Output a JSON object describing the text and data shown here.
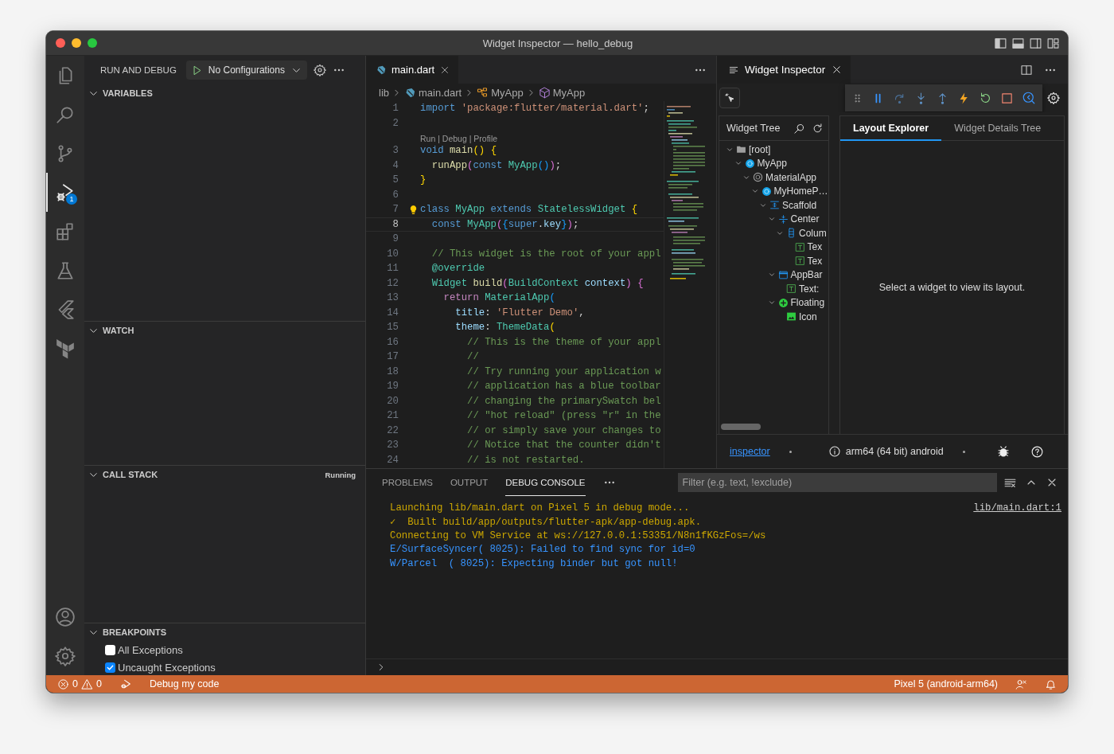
{
  "window": {
    "title": "Widget Inspector — hello_debug"
  },
  "activity_bar": {
    "items": [
      {
        "kind": "files",
        "selected": false
      },
      {
        "kind": "search",
        "selected": false
      },
      {
        "kind": "source-control",
        "selected": false
      },
      {
        "kind": "run-debug",
        "selected": true,
        "badge": "1"
      },
      {
        "kind": "extensions",
        "selected": false
      },
      {
        "kind": "testing",
        "selected": false
      },
      {
        "kind": "flutter",
        "selected": false
      },
      {
        "kind": "terraform",
        "selected": false
      }
    ],
    "bottom_items": [
      {
        "kind": "account"
      },
      {
        "kind": "manage"
      }
    ]
  },
  "sidebar": {
    "title": "RUN AND DEBUG",
    "configuration": "No Configurations",
    "sections": [
      {
        "title": "VARIABLES",
        "expanded": true
      },
      {
        "title": "WATCH",
        "expanded": true
      },
      {
        "title": "CALL STACK",
        "expanded": true,
        "status": "Running"
      },
      {
        "title": "BREAKPOINTS",
        "expanded": true,
        "items": [
          {
            "label": "All Exceptions",
            "checked": false
          },
          {
            "label": "Uncaught Exceptions",
            "checked": true
          }
        ]
      }
    ]
  },
  "editor": {
    "tabs": [
      {
        "label": "main.dart",
        "selected": true
      }
    ],
    "breadcrumbs": [
      {
        "label": "lib",
        "kind": "folder"
      },
      {
        "label": "main.dart",
        "kind": "file"
      },
      {
        "label": "MyApp",
        "kind": "class"
      },
      {
        "label": "MyApp",
        "kind": "constructor"
      }
    ],
    "lines": [
      {
        "kind": "code",
        "number": "1",
        "current": false,
        "lightbulb": false,
        "text": "import 'package:flutter/material.dart';"
      },
      {
        "kind": "code",
        "number": "2",
        "current": false,
        "lightbulb": false
      },
      {
        "kind": "codelens",
        "text": "Run | Debug | Profile"
      },
      {
        "kind": "code",
        "number": "3",
        "current": false,
        "lightbulb": false,
        "text": "void main() {"
      },
      {
        "kind": "code",
        "number": "4",
        "current": false,
        "lightbulb": false,
        "text": "  runApp(const MyApp());"
      },
      {
        "kind": "code",
        "number": "5",
        "current": false,
        "lightbulb": false,
        "text": "}"
      },
      {
        "kind": "code",
        "number": "6",
        "current": false,
        "lightbulb": false
      },
      {
        "kind": "code",
        "number": "7",
        "current": false,
        "lightbulb": true,
        "text": "class MyApp extends StatelessWidget {"
      },
      {
        "kind": "code",
        "number": "8",
        "current": true,
        "lightbulb": false,
        "text": "  const MyApp({super.key});"
      },
      {
        "kind": "code",
        "number": "9",
        "current": false,
        "lightbulb": false
      },
      {
        "kind": "code",
        "number": "10",
        "current": false,
        "lightbulb": false,
        "text": "  // This widget is the root of your appl"
      },
      {
        "kind": "code",
        "number": "11",
        "current": false,
        "lightbulb": false,
        "text": "  @override"
      },
      {
        "kind": "code",
        "number": "12",
        "current": false,
        "lightbulb": false,
        "text": "  Widget build(BuildContext context) {"
      },
      {
        "kind": "code",
        "number": "13",
        "current": false,
        "lightbulb": false,
        "text": "    return MaterialApp("
      },
      {
        "kind": "code",
        "number": "14",
        "current": false,
        "lightbulb": false,
        "text": "      title: 'Flutter Demo',"
      },
      {
        "kind": "code",
        "number": "15",
        "current": false,
        "lightbulb": false,
        "text": "      theme: ThemeData("
      },
      {
        "kind": "code",
        "number": "16",
        "current": false,
        "lightbulb": false,
        "text": "        // This is the theme of your appl"
      },
      {
        "kind": "code",
        "number": "17",
        "current": false,
        "lightbulb": false,
        "text": "        //"
      },
      {
        "kind": "code",
        "number": "18",
        "current": false,
        "lightbulb": false,
        "text": "        // Try running your application w"
      },
      {
        "kind": "code",
        "number": "19",
        "current": false,
        "lightbulb": false,
        "text": "        // application has a blue toolbar"
      },
      {
        "kind": "code",
        "number": "20",
        "current": false,
        "lightbulb": false,
        "text": "        // changing the primarySwatch bel"
      },
      {
        "kind": "code",
        "number": "21",
        "current": false,
        "lightbulb": false,
        "text": "        // \"hot reload\" (press \"r\" in the"
      },
      {
        "kind": "code",
        "number": "22",
        "current": false,
        "lightbulb": false,
        "text": "        // or simply save your changes to"
      },
      {
        "kind": "code",
        "number": "23",
        "current": false,
        "lightbulb": false,
        "text": "        // Notice that the counter didn't"
      },
      {
        "kind": "code",
        "number": "24",
        "current": false,
        "lightbulb": false,
        "text": "        // is not restarted."
      }
    ]
  },
  "inspector": {
    "tab": "Widget Inspector",
    "tree_title": "Widget Tree",
    "tree": [
      {
        "label": "[root]",
        "kind": "folder",
        "expanded": true,
        "children": [
          {
            "label": "MyApp",
            "kind": "stateless",
            "expanded": true,
            "children": [
              {
                "label": "MaterialApp",
                "kind": "material",
                "expanded": true,
                "children": [
                  {
                    "label": "MyHomeP…",
                    "kind": "stateless",
                    "expanded": true,
                    "children": [
                      {
                        "label": "Scaffold",
                        "kind": "scaffold",
                        "expanded": true,
                        "children": [
                          {
                            "label": "Center",
                            "kind": "center",
                            "expanded": true,
                            "children": [
                              {
                                "label": "Colum",
                                "kind": "column",
                                "expanded": true,
                                "children": [
                                  {
                                    "label": "Tex",
                                    "kind": "text"
                                  },
                                  {
                                    "label": "Tex",
                                    "kind": "text"
                                  }
                                ]
                              }
                            ]
                          },
                          {
                            "label": "AppBar",
                            "kind": "appbar",
                            "expanded": true,
                            "children": [
                              {
                                "label": "Text:",
                                "kind": "text"
                              }
                            ]
                          },
                          {
                            "label": "Floating",
                            "kind": "fab",
                            "expanded": true,
                            "children": [
                              {
                                "label": "Icon",
                                "kind": "image"
                              }
                            ]
                          }
                        ]
                      }
                    ]
                  }
                ]
              }
            ]
          }
        ]
      }
    ],
    "detail_tabs": [
      {
        "label": "Layout Explorer",
        "selected": true
      },
      {
        "label": "Widget Details Tree",
        "selected": false
      }
    ],
    "message": "Select a widget to view its layout.",
    "footer": {
      "link": "inspector",
      "device": "arm64 (64 bit) android"
    }
  },
  "panel": {
    "tabs": [
      {
        "label": "PROBLEMS",
        "selected": false
      },
      {
        "label": "OUTPUT",
        "selected": false
      },
      {
        "label": "DEBUG CONSOLE",
        "selected": true
      }
    ],
    "filter_placeholder": "Filter (e.g. text, !exclude)",
    "lines": [
      {
        "text": "Launching lib/main.dart on Pixel 5 in debug mode...",
        "color": "#cca700",
        "source": "lib/main.dart:1"
      },
      {
        "text": "✓  Built build/app/outputs/flutter-apk/app-debug.apk.",
        "color": "#cca700"
      },
      {
        "text": "Connecting to VM Service at ws://127.0.0.1:53351/N8n1fKGzFos=/ws",
        "color": "#cca700"
      },
      {
        "text": "E/SurfaceSyncer( 8025): Failed to find sync for id=0",
        "color": "#3794ff"
      },
      {
        "text": "W/Parcel  ( 8025): Expecting binder but got null!",
        "color": "#3794ff"
      }
    ]
  },
  "status_bar": {
    "errors": "0",
    "warnings": "0",
    "debug_label": "Debug my code",
    "device": "Pixel 5 (android-arm64)"
  }
}
